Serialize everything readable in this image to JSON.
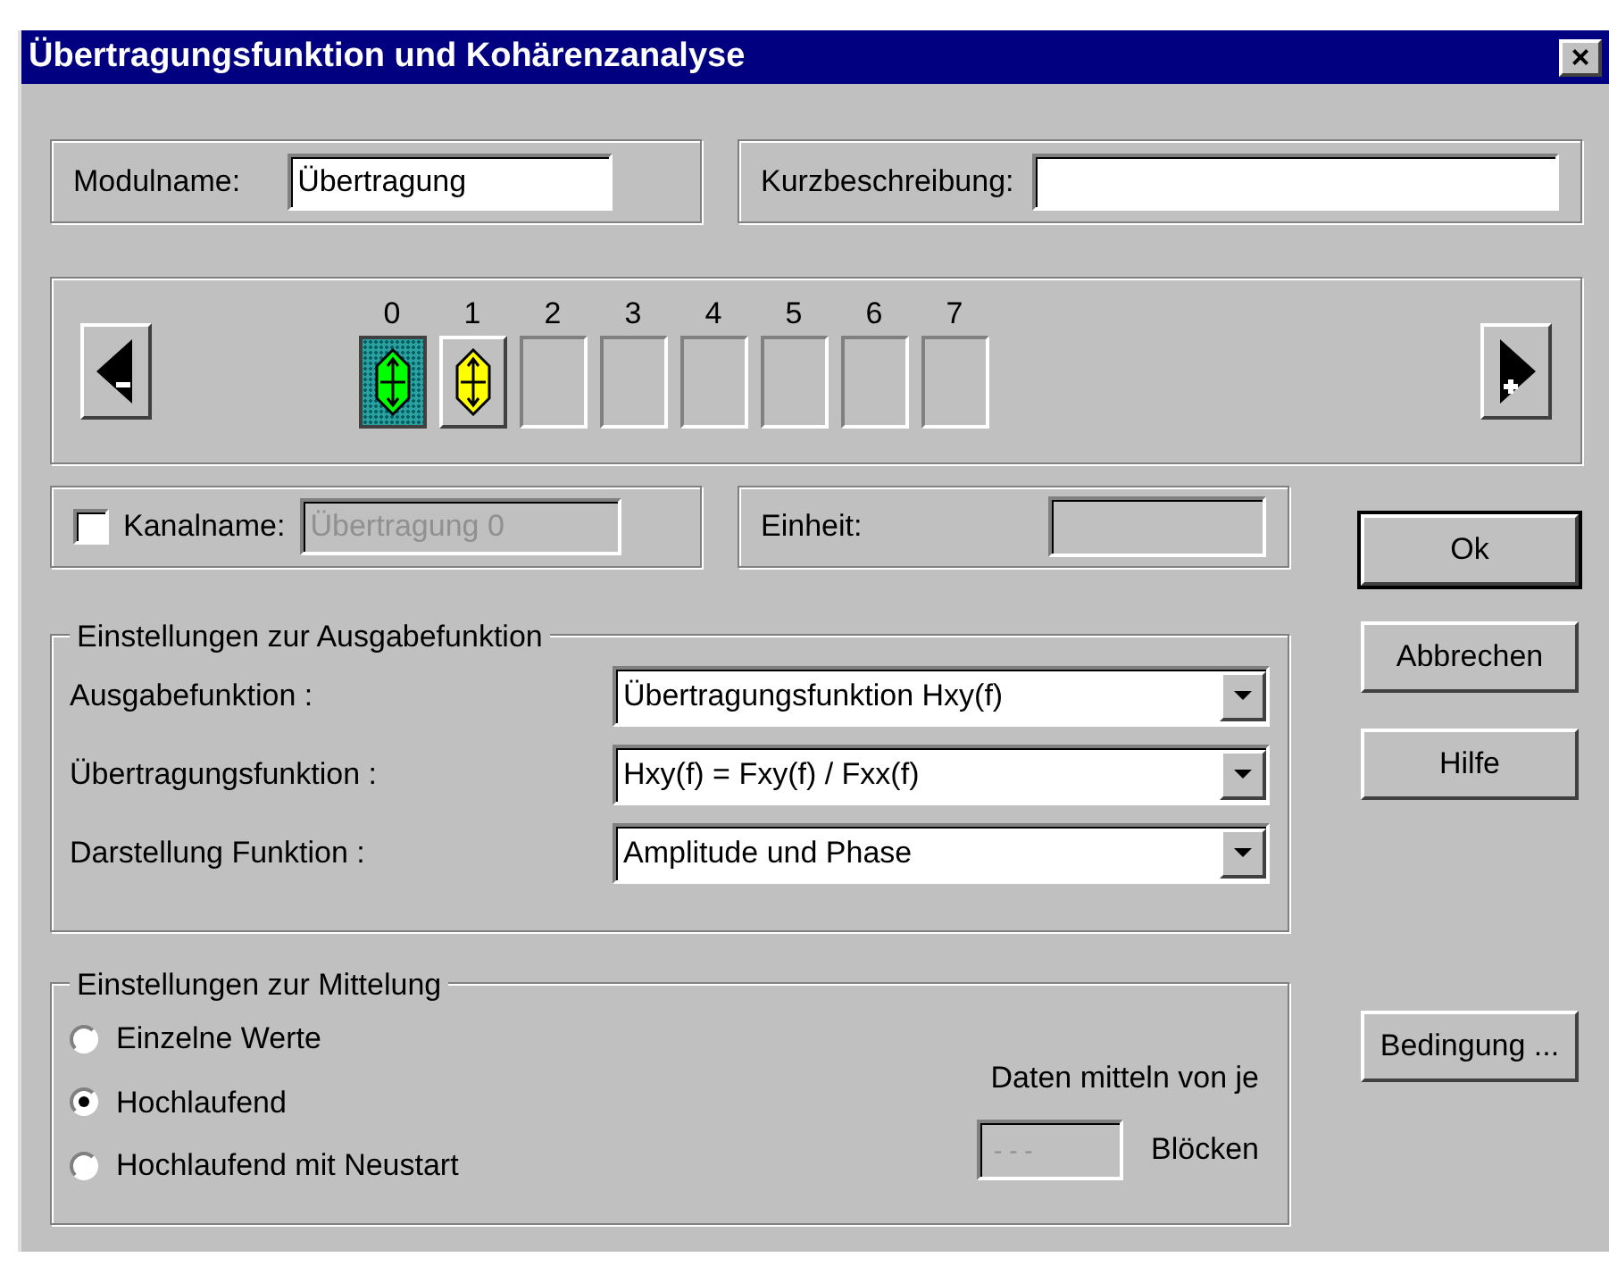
{
  "window": {
    "title": "Übertragungsfunktion und Kohärenzanalyse",
    "close": "×"
  },
  "module": {
    "name_label": "Modulname:",
    "name_value": "Übertragung",
    "desc_label": "Kurzbeschreibung:"
  },
  "channels": [
    {
      "label": "0",
      "kind": "signal",
      "color": "#00ff00",
      "selected": true
    },
    {
      "label": "1",
      "kind": "signal",
      "color": "#ffff00",
      "selected": false
    },
    {
      "label": "2",
      "kind": "empty",
      "selected": false
    },
    {
      "label": "3",
      "kind": "empty",
      "selected": false
    },
    {
      "label": "4",
      "kind": "empty",
      "selected": false
    },
    {
      "label": "5",
      "kind": "empty",
      "selected": false
    },
    {
      "label": "6",
      "kind": "empty",
      "selected": false
    },
    {
      "label": "7",
      "kind": "empty",
      "selected": false
    }
  ],
  "channel_name": {
    "checked": false,
    "label": "Kanalname:",
    "value": "Übertragung 0",
    "disabled": true
  },
  "unit": {
    "label": "Einheit:"
  },
  "output": {
    "title": "Einstellungen zur Ausgabefunktion",
    "rows": [
      {
        "label": "Ausgabefunktion :",
        "value": "Übertragungsfunktion Hxy(f)"
      },
      {
        "label": "Übertragungsfunktion :",
        "value": "Hxy(f) = Fxy(f) / Fxx(f)"
      },
      {
        "label": "Darstellung Funktion :",
        "value": "Amplitude und Phase"
      }
    ]
  },
  "averaging": {
    "title": "Einstellungen zur Mittelung",
    "options": [
      {
        "label": "Einzelne Werte",
        "selected": false
      },
      {
        "label": "Hochlaufend",
        "selected": true
      },
      {
        "label": "Hochlaufend mit Neustart",
        "selected": false
      }
    ],
    "blocks_label": "Daten mitteln von je",
    "blocks_value": "- - -",
    "blocks_unit": "Blöcken"
  },
  "buttons": [
    {
      "label": "Ok",
      "default": true
    },
    {
      "label": "Abbrechen",
      "default": false
    },
    {
      "label": "Hilfe",
      "default": false
    }
  ],
  "condition_button": "Bedingung ..."
}
